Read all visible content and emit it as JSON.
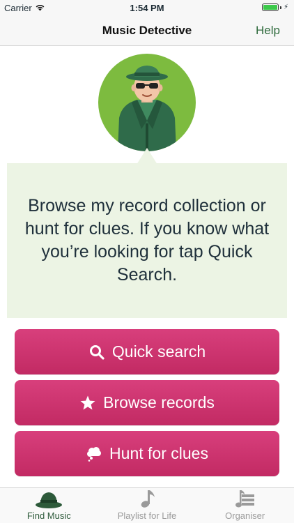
{
  "status_bar": {
    "carrier": "Carrier",
    "time": "1:54 PM"
  },
  "nav": {
    "title": "Music Detective",
    "help_label": "Help"
  },
  "bubble": {
    "text": "Browse my record collection or hunt for clues. If you know what you’re looking for tap Quick Search."
  },
  "buttons": {
    "quick_search": "Quick search",
    "browse_records": "Browse records",
    "hunt_for_clues": "Hunt for clues"
  },
  "tabs": [
    {
      "label": "Find Music",
      "icon": "detective-hat-icon",
      "active": true
    },
    {
      "label": "Playlist for Life",
      "icon": "music-note-icon",
      "active": false
    },
    {
      "label": "Organiser",
      "icon": "organiser-icon",
      "active": false
    }
  ],
  "colors": {
    "button": "#cc3170",
    "bubble": "#ecf4e4",
    "avatar_bg": "#7dbb3f",
    "accent": "#2f6b3d",
    "battery": "#3cc94a"
  }
}
